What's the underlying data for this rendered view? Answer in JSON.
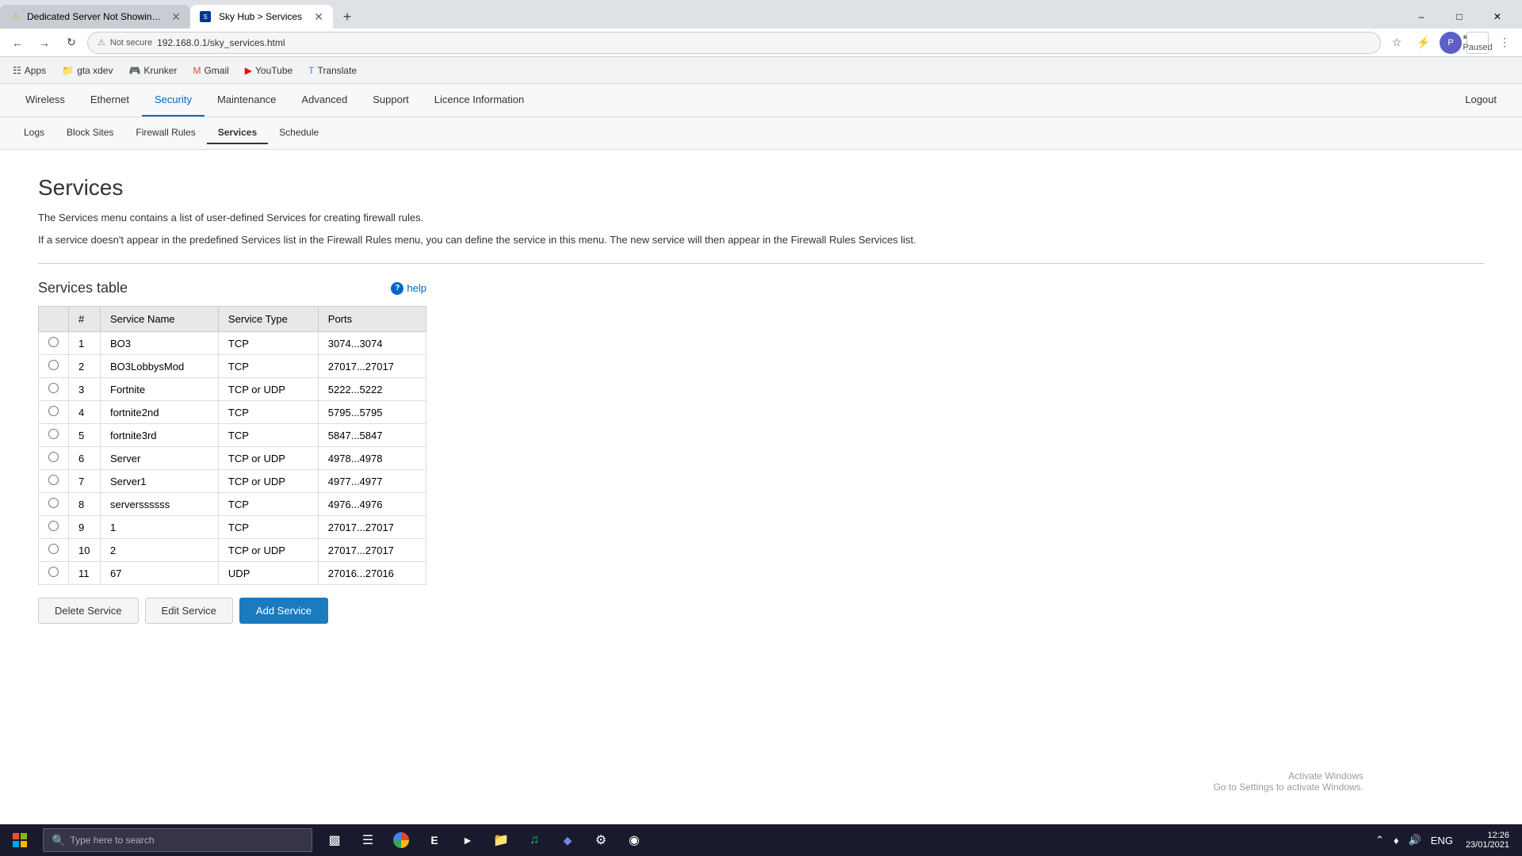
{
  "browser": {
    "tabs": [
      {
        "id": 1,
        "title": "Dedicated Server Not Showing U...",
        "active": false,
        "favicon": "warning"
      },
      {
        "id": 2,
        "title": "Sky Hub > Services",
        "active": true,
        "favicon": "sky"
      }
    ],
    "url": "192.168.0.1/sky_services.html",
    "security_text": "Not secure"
  },
  "bookmarks": [
    {
      "label": "Apps",
      "icon": "grid"
    },
    {
      "label": "gta xdev",
      "icon": "folder"
    },
    {
      "label": "Krunker",
      "icon": "link"
    },
    {
      "label": "Gmail",
      "icon": "mail"
    },
    {
      "label": "YouTube",
      "icon": "youtube"
    },
    {
      "label": "Translate",
      "icon": "translate"
    }
  ],
  "router_nav": {
    "top_items": [
      {
        "label": "Wireless",
        "active": false
      },
      {
        "label": "Ethernet",
        "active": false
      },
      {
        "label": "Security",
        "active": true
      },
      {
        "label": "Maintenance",
        "active": false
      },
      {
        "label": "Advanced",
        "active": false
      },
      {
        "label": "Support",
        "active": false
      },
      {
        "label": "Licence Information",
        "active": false
      },
      {
        "label": "Logout",
        "active": false
      }
    ],
    "sub_items": [
      {
        "label": "Logs",
        "active": false
      },
      {
        "label": "Block Sites",
        "active": false
      },
      {
        "label": "Firewall Rules",
        "active": false
      },
      {
        "label": "Services",
        "active": true
      },
      {
        "label": "Schedule",
        "active": false
      }
    ]
  },
  "page": {
    "title": "Services",
    "desc1": "The Services menu contains a list of user-defined Services for creating firewall rules.",
    "desc2": "If a service doesn't appear in the predefined Services list in the Firewall Rules menu, you can define the service in this menu. The new service will then appear in the Firewall Rules Services list.",
    "section_title": "Services table",
    "help_label": "help"
  },
  "table": {
    "headers": [
      "#",
      "Service Name",
      "Service Type",
      "Ports"
    ],
    "rows": [
      {
        "num": 1,
        "name": "BO3",
        "type": "TCP",
        "ports": "3074...3074"
      },
      {
        "num": 2,
        "name": "BO3LobbysMod",
        "type": "TCP",
        "ports": "27017...27017"
      },
      {
        "num": 3,
        "name": "Fortnite",
        "type": "TCP or UDP",
        "ports": "5222...5222"
      },
      {
        "num": 4,
        "name": "fortnite2nd",
        "type": "TCP",
        "ports": "5795...5795"
      },
      {
        "num": 5,
        "name": "fortnite3rd",
        "type": "TCP",
        "ports": "5847...5847"
      },
      {
        "num": 6,
        "name": "Server",
        "type": "TCP or UDP",
        "ports": "4978...4978"
      },
      {
        "num": 7,
        "name": "Server1",
        "type": "TCP or UDP",
        "ports": "4977...4977"
      },
      {
        "num": 8,
        "name": "serverssssss",
        "type": "TCP",
        "ports": "4976...4976"
      },
      {
        "num": 9,
        "name": "1",
        "type": "TCP",
        "ports": "27017...27017"
      },
      {
        "num": 10,
        "name": "2",
        "type": "TCP or UDP",
        "ports": "27017...27017"
      },
      {
        "num": 11,
        "name": "67",
        "type": "UDP",
        "ports": "27016...27016"
      }
    ]
  },
  "buttons": {
    "delete": "Delete Service",
    "edit": "Edit Service",
    "add": "Add Service"
  },
  "taskbar": {
    "search_placeholder": "Type here to search",
    "time": "12:26",
    "date": "23/01/2021",
    "lang": "ENG"
  },
  "win_activate": {
    "line1": "Activate Windows",
    "line2": "Go to Settings to activate Windows."
  }
}
